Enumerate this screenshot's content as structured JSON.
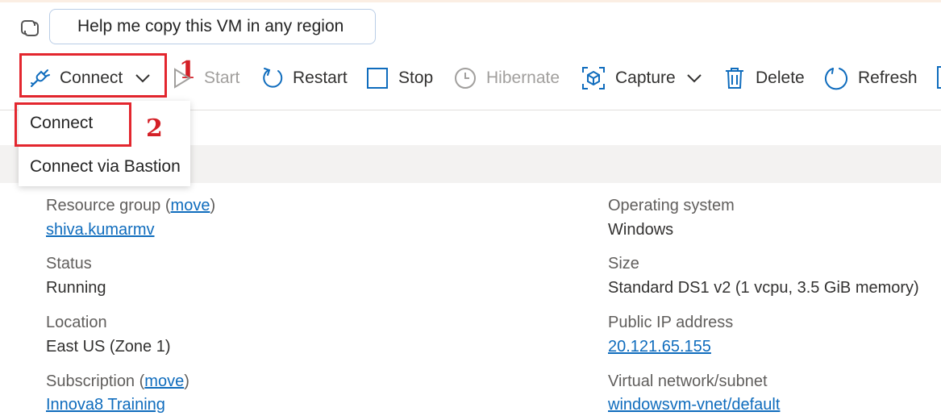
{
  "copilot": {
    "suggestion": "Help me copy this VM in any region"
  },
  "toolbar": {
    "connect": "Connect",
    "start": "Start",
    "restart": "Restart",
    "stop": "Stop",
    "hibernate": "Hibernate",
    "capture": "Capture",
    "delete": "Delete",
    "refresh": "Refresh"
  },
  "connect_menu": {
    "items": [
      "Connect",
      "Connect via Bastion"
    ]
  },
  "annotations": {
    "marker_1": "1",
    "marker_2": "2"
  },
  "essentials": {
    "left": {
      "resource_group_label": "Resource group",
      "resource_group_move": "move",
      "resource_group_value": "shiva.kumarmv",
      "status_label": "Status",
      "status_value": "Running",
      "location_label": "Location",
      "location_value": "East US (Zone 1)",
      "subscription_label": "Subscription",
      "subscription_move": "move",
      "subscription_value": "Innova8 Training"
    },
    "right": {
      "os_label": "Operating system",
      "os_value": "Windows",
      "size_label": "Size",
      "size_value": "Standard DS1 v2 (1 vcpu, 3.5 GiB memory)",
      "public_ip_label": "Public IP address",
      "public_ip_value": "20.121.65.155",
      "vnet_label": "Virtual network/subnet",
      "vnet_value": "windowsvm-vnet/default"
    }
  },
  "colors": {
    "accent": "#0f6cbd",
    "highlight": "#e3262e",
    "annotation": "#d42027"
  }
}
